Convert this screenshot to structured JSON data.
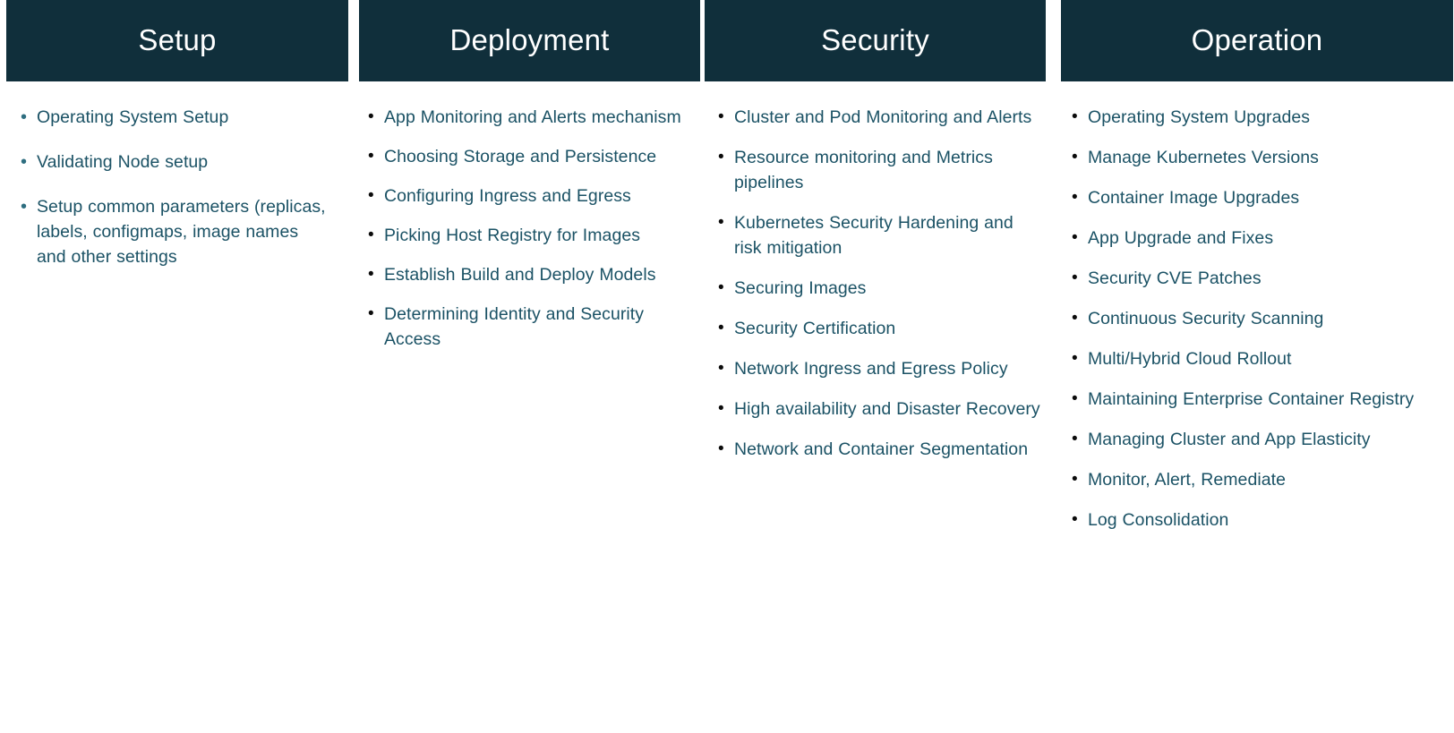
{
  "theme": {
    "header_background": "#102F3B",
    "header_text": "#FFFFFF",
    "body_text": "#1B5265",
    "bullet_accent": "#2E6E80",
    "bullet_dark": "#0B0B0B",
    "page_background": "#FFFFFF"
  },
  "bullet_glyph": "•",
  "columns": [
    {
      "id": "setup",
      "title": "Setup",
      "items": [
        "Operating System Setup",
        "Validating Node setup",
        "Setup common parameters (replicas, labels, configmaps, image names and other settings"
      ]
    },
    {
      "id": "deployment",
      "title": "Deployment",
      "items": [
        "App Monitoring and Alerts mechanism",
        "Choosing Storage and Persistence",
        "Configuring Ingress and Egress",
        "Picking Host Registry for Images",
        "Establish Build and Deploy Models",
        "Determining Identity and Security Access"
      ]
    },
    {
      "id": "security",
      "title": "Security",
      "items": [
        "Cluster and Pod Monitoring and Alerts",
        "Resource monitoring and Metrics pipelines",
        "Kubernetes Security Hardening and risk mitigation",
        "Securing Images",
        "Security Certification",
        "Network Ingress and Egress Policy",
        "High availability and Disaster Recovery",
        "Network and Container Segmentation"
      ]
    },
    {
      "id": "operation",
      "title": "Operation",
      "items": [
        "Operating System Upgrades",
        "Manage Kubernetes Versions",
        "Container Image Upgrades",
        "App Upgrade and Fixes",
        "Security CVE Patches",
        "Continuous Security Scanning",
        "Multi/Hybrid Cloud Rollout",
        "Maintaining Enterprise Container Registry",
        "Managing Cluster and App Elasticity",
        "Monitor, Alert, Remediate",
        "Log Consolidation"
      ]
    }
  ]
}
